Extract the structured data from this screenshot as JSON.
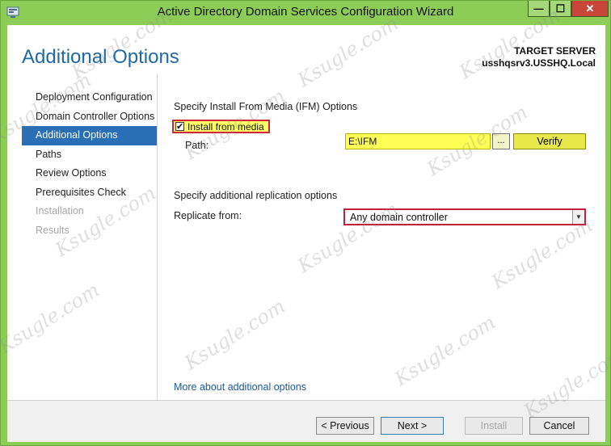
{
  "window": {
    "title": "Active Directory Domain Services Configuration Wizard",
    "controls": {
      "minimize": "—",
      "maximize": "☐",
      "close": "✕"
    }
  },
  "header": {
    "page_title": "Additional Options",
    "target_label": "TARGET SERVER",
    "target_server": "usshqsrv3.USSHQ.Local"
  },
  "sidebar": {
    "items": [
      {
        "label": "Deployment Configuration",
        "state": "normal"
      },
      {
        "label": "Domain Controller Options",
        "state": "normal"
      },
      {
        "label": "Additional Options",
        "state": "active"
      },
      {
        "label": "Paths",
        "state": "normal"
      },
      {
        "label": "Review Options",
        "state": "normal"
      },
      {
        "label": "Prerequisites Check",
        "state": "normal"
      },
      {
        "label": "Installation",
        "state": "disabled"
      },
      {
        "label": "Results",
        "state": "disabled"
      }
    ]
  },
  "ifm": {
    "heading": "Specify Install From Media (IFM) Options",
    "checkbox_label": "Install from media",
    "checked": true,
    "path_label": "Path:",
    "path_value": "E:\\IFM",
    "browse_label": "...",
    "verify_label": "Verify"
  },
  "replication": {
    "heading": "Specify additional replication options",
    "label": "Replicate from:",
    "selected": "Any domain controller"
  },
  "more_link": "More about additional options",
  "footer": {
    "previous": "< Previous",
    "next": "Next >",
    "install": "Install",
    "cancel": "Cancel"
  },
  "watermark": "Ksugle.com",
  "colors": {
    "frame": "#8dcd57",
    "accent": "#2a6fb5",
    "title": "#1d6aa5",
    "highlight": "#ffff55",
    "annotation": "#d0253b"
  },
  "icons": {
    "app": "server-manager-icon",
    "dropdown": "chevron-down-icon"
  }
}
